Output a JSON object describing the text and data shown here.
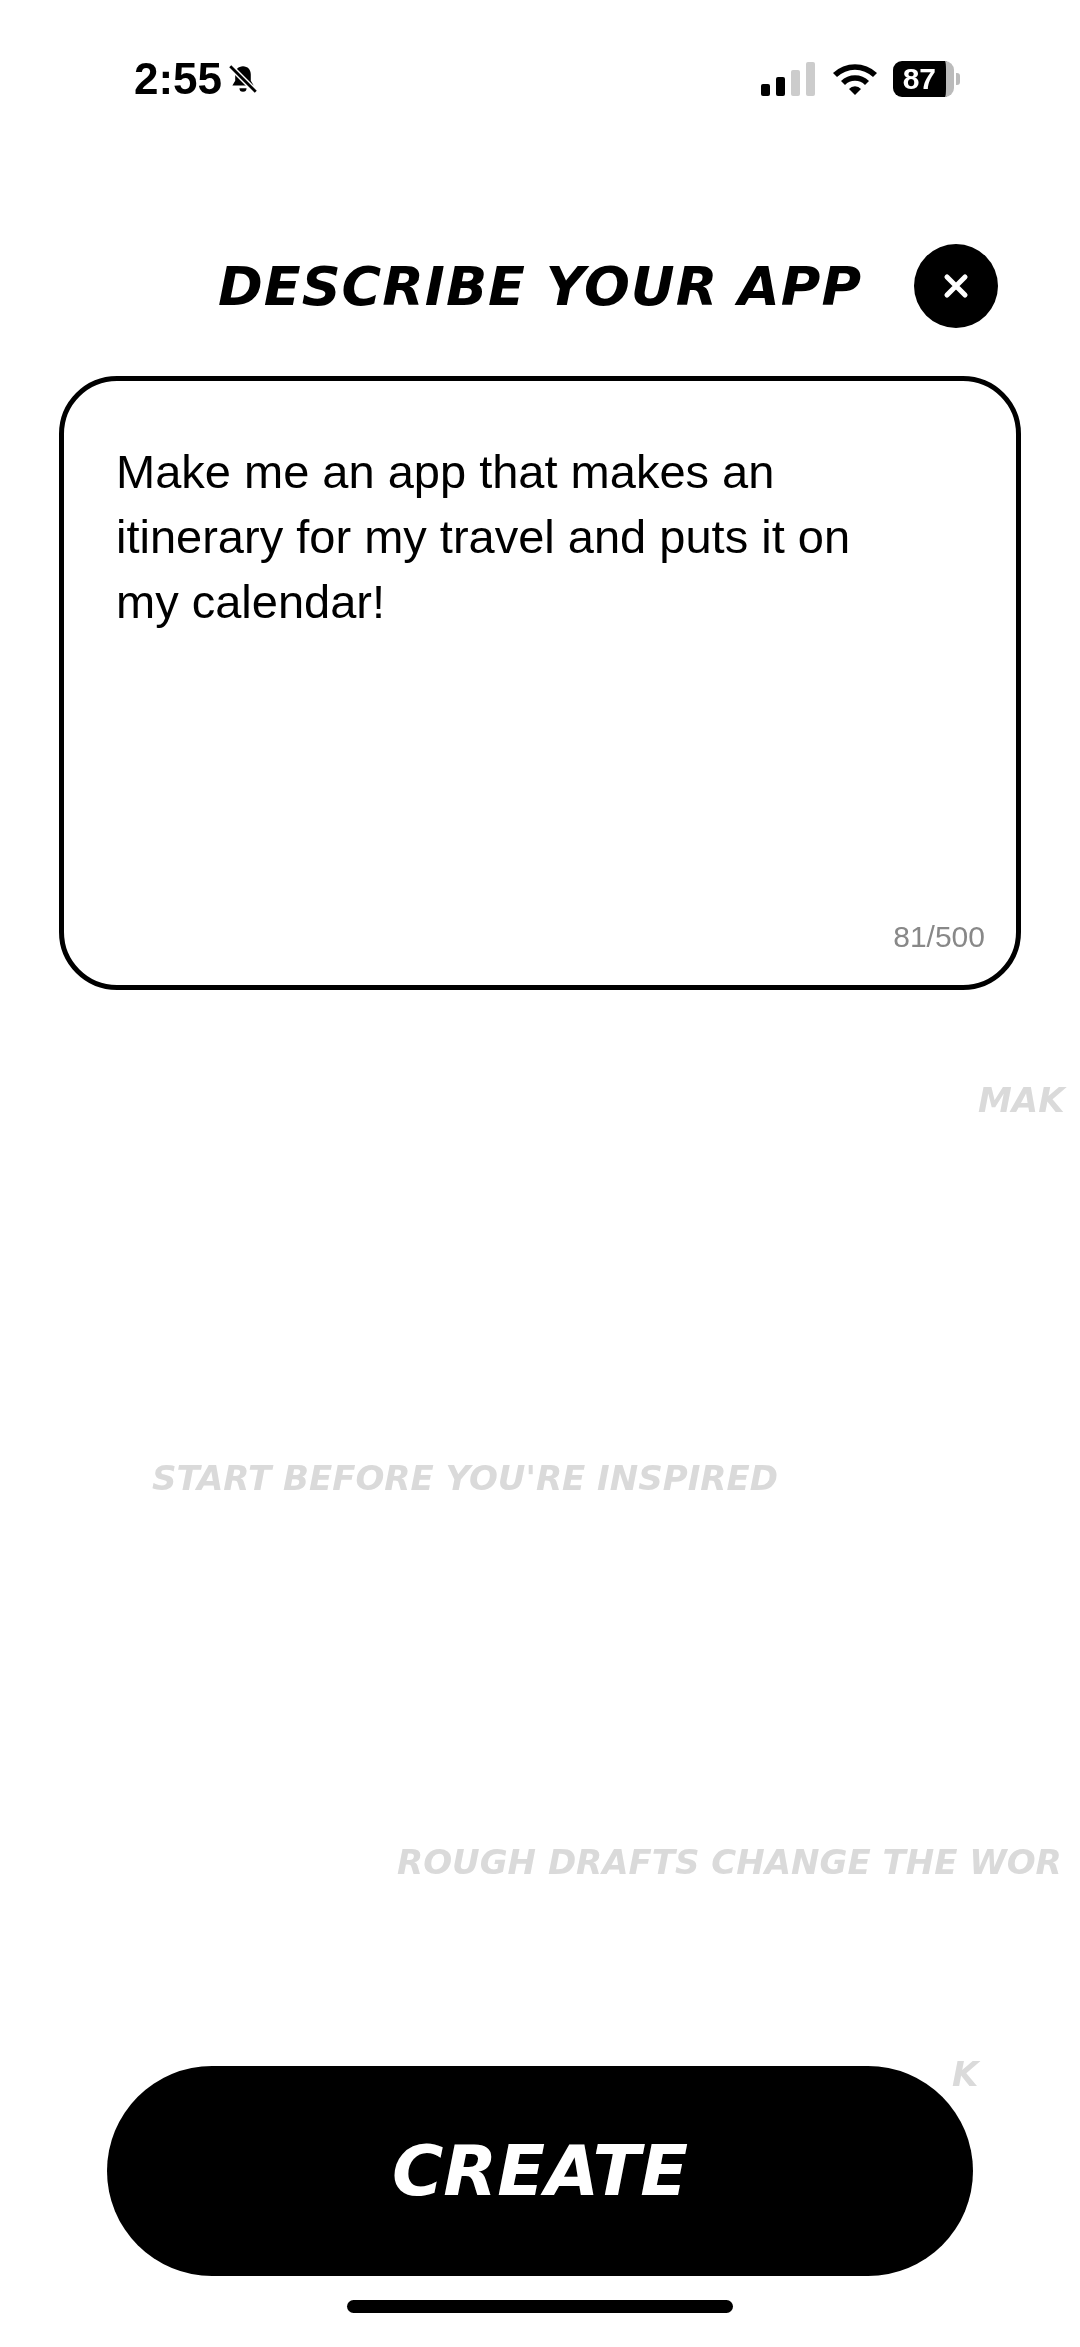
{
  "status_bar": {
    "time": "2:55",
    "battery": "87"
  },
  "header": {
    "title": "DESCRIBE YOUR APP"
  },
  "description": {
    "value": "Make me an app that makes an itinerary for my travel and puts it on my calendar!",
    "counter": "81/500"
  },
  "background_phrases": [
    {
      "text": "MAK"
    },
    {
      "text": "START BEFORE YOU'RE INSPIRED"
    },
    {
      "text": "ROUGH DRAFTS CHANGE THE WOR"
    },
    {
      "text": "K"
    }
  ],
  "create_button": {
    "label": "CREATE"
  }
}
